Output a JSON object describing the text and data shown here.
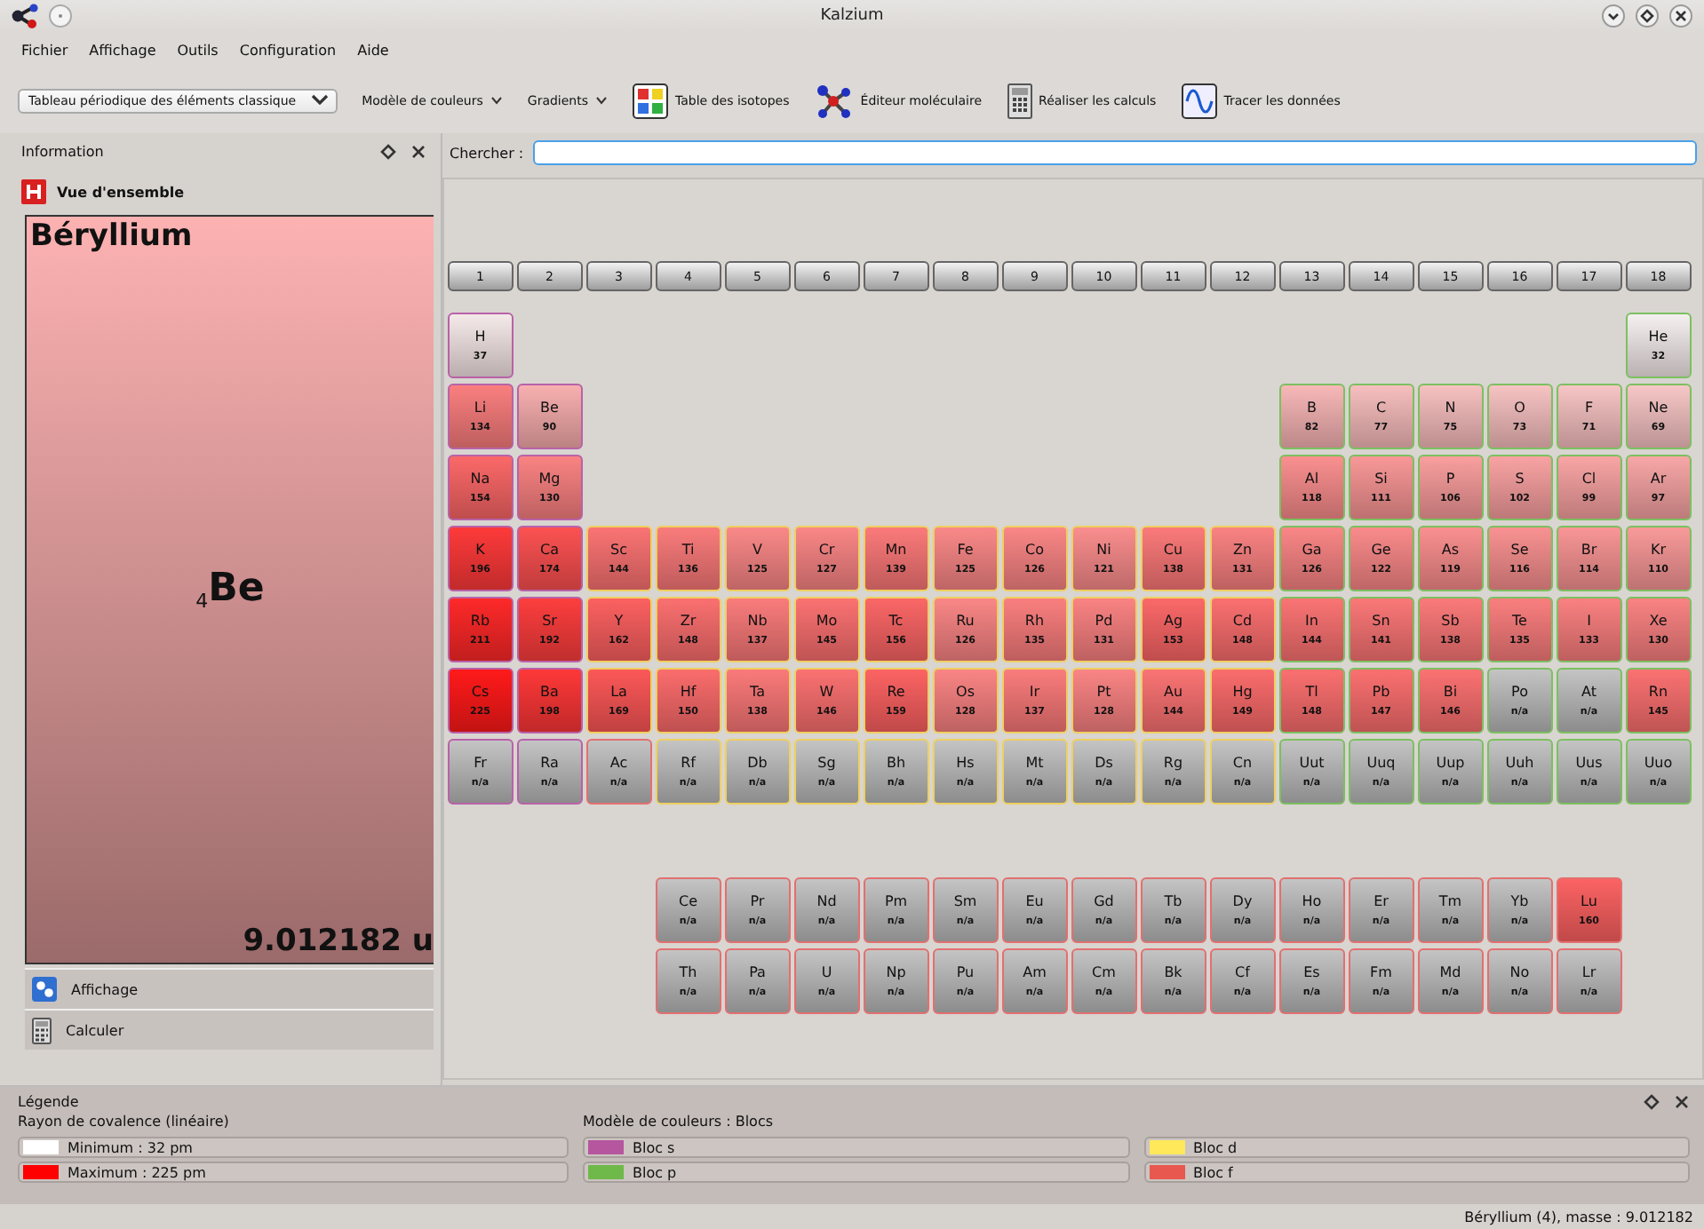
{
  "window": {
    "title": "Kalzium"
  },
  "menu": [
    "Fichier",
    "Affichage",
    "Outils",
    "Configuration",
    "Aide"
  ],
  "toolbar": {
    "table_combo": "Tableau périodique des éléments classique",
    "items": [
      {
        "label": "Modèle de couleurs",
        "kind": "dropdown"
      },
      {
        "label": "Gradients",
        "kind": "dropdown"
      },
      {
        "label": "Table des isotopes",
        "kind": "isotopes"
      },
      {
        "label": "Éditeur moléculaire",
        "kind": "molecule"
      },
      {
        "label": "Réaliser les calculs",
        "kind": "calculator"
      },
      {
        "label": "Tracer les données",
        "kind": "plot"
      }
    ]
  },
  "info_panel": {
    "title": "Information",
    "section": "Vue d'ensemble",
    "element": {
      "name": "Béryllium",
      "number": "4",
      "symbol": "Be",
      "mass": "9.012182 u"
    },
    "tabs": [
      {
        "label": "Affichage",
        "kind": "display"
      },
      {
        "label": "Calculer",
        "kind": "calculator"
      }
    ]
  },
  "search": {
    "label": "Chercher :"
  },
  "table": {
    "groups": [
      "1",
      "2",
      "3",
      "4",
      "5",
      "6",
      "7",
      "8",
      "9",
      "10",
      "11",
      "12",
      "13",
      "14",
      "15",
      "16",
      "17",
      "18"
    ],
    "rows": [
      {
        "kind": "main",
        "left": [
          {
            "symbol": "H",
            "value": "37",
            "kind": "s-block",
            "color": "#f5eaea"
          }
        ],
        "right": [
          {
            "symbol": "He",
            "value": "32",
            "kind": "p-block",
            "color": "#f5f0f0"
          }
        ]
      },
      {
        "kind": "main",
        "left": [
          {
            "symbol": "Li",
            "value": "134",
            "kind": "s-block",
            "color": "#fa7f7f"
          },
          {
            "symbol": "Be",
            "value": "90",
            "kind": "s-block",
            "color": "#f8b0b0"
          }
        ],
        "right": [
          {
            "symbol": "B",
            "value": "82",
            "kind": "p-block",
            "color": "#f8b8b8"
          },
          {
            "symbol": "C",
            "value": "77",
            "kind": "p-block",
            "color": "#f7bfbf"
          },
          {
            "symbol": "N",
            "value": "75",
            "kind": "p-block",
            "color": "#f7c1c1"
          },
          {
            "symbol": "O",
            "value": "73",
            "kind": "p-block",
            "color": "#f7c3c3"
          },
          {
            "symbol": "F",
            "value": "71",
            "kind": "p-block",
            "color": "#f7c5c5"
          },
          {
            "symbol": "Ne",
            "value": "69",
            "kind": "p-block",
            "color": "#f7c7c7"
          }
        ]
      },
      {
        "kind": "main",
        "left": [
          {
            "symbol": "Na",
            "value": "154",
            "kind": "s-block",
            "color": "#fb6969"
          },
          {
            "symbol": "Mg",
            "value": "130",
            "kind": "s-block",
            "color": "#fa8383"
          }
        ],
        "right": [
          {
            "symbol": "Al",
            "value": "118",
            "kind": "p-block",
            "color": "#fa9090"
          },
          {
            "symbol": "Si",
            "value": "111",
            "kind": "p-block",
            "color": "#f99898"
          },
          {
            "symbol": "P",
            "value": "106",
            "kind": "p-block",
            "color": "#f99f9f"
          },
          {
            "symbol": "S",
            "value": "102",
            "kind": "p-block",
            "color": "#f9a3a3"
          },
          {
            "symbol": "Cl",
            "value": "99",
            "kind": "p-block",
            "color": "#f9a5a5"
          },
          {
            "symbol": "Ar",
            "value": "97",
            "kind": "p-block",
            "color": "#f8a7a7"
          }
        ]
      },
      {
        "kind": "main",
        "left": [
          {
            "symbol": "K",
            "value": "196",
            "kind": "s-block",
            "color": "#fe3a3a"
          },
          {
            "symbol": "Ca",
            "value": "174",
            "kind": "s-block",
            "color": "#fc5252"
          },
          {
            "symbol": "Sc",
            "value": "144",
            "kind": "d-block",
            "color": "#fb7474"
          },
          {
            "symbol": "Ti",
            "value": "136",
            "kind": "d-block",
            "color": "#fa7c7c"
          },
          {
            "symbol": "V",
            "value": "125",
            "kind": "d-block",
            "color": "#fa8989"
          },
          {
            "symbol": "Cr",
            "value": "127",
            "kind": "d-block",
            "color": "#fa8787"
          },
          {
            "symbol": "Mn",
            "value": "139",
            "kind": "d-block",
            "color": "#fb7a7a"
          },
          {
            "symbol": "Fe",
            "value": "125",
            "kind": "d-block",
            "color": "#fa8989"
          },
          {
            "symbol": "Co",
            "value": "126",
            "kind": "d-block",
            "color": "#fa8787"
          },
          {
            "symbol": "Ni",
            "value": "121",
            "kind": "d-block",
            "color": "#fa8e8e"
          },
          {
            "symbol": "Cu",
            "value": "138",
            "kind": "d-block",
            "color": "#fb7a7a"
          },
          {
            "symbol": "Zn",
            "value": "131",
            "kind": "d-block",
            "color": "#fa8383"
          },
          {
            "symbol": "Ga",
            "value": "126",
            "kind": "p-block",
            "color": "#fa8787"
          },
          {
            "symbol": "Ge",
            "value": "122",
            "kind": "p-block",
            "color": "#fa8b8b"
          },
          {
            "symbol": "As",
            "value": "119",
            "kind": "p-block",
            "color": "#fa9090"
          },
          {
            "symbol": "Se",
            "value": "116",
            "kind": "p-block",
            "color": "#f99292"
          },
          {
            "symbol": "Br",
            "value": "114",
            "kind": "p-block",
            "color": "#f99696"
          },
          {
            "symbol": "Kr",
            "value": "110",
            "kind": "p-block",
            "color": "#f99a9a"
          }
        ],
        "right": []
      },
      {
        "kind": "main",
        "left": [
          {
            "symbol": "Rb",
            "value": "211",
            "kind": "s-block",
            "color": "#fe2929"
          },
          {
            "symbol": "Sr",
            "value": "192",
            "kind": "s-block",
            "color": "#fd3e3e"
          },
          {
            "symbol": "Y",
            "value": "162",
            "kind": "d-block",
            "color": "#fc6161"
          },
          {
            "symbol": "Zr",
            "value": "148",
            "kind": "d-block",
            "color": "#fb7070"
          },
          {
            "symbol": "Nb",
            "value": "137",
            "kind": "d-block",
            "color": "#fa7c7c"
          },
          {
            "symbol": "Mo",
            "value": "145",
            "kind": "d-block",
            "color": "#fb7272"
          },
          {
            "symbol": "Tc",
            "value": "156",
            "kind": "d-block",
            "color": "#fb6767"
          },
          {
            "symbol": "Ru",
            "value": "126",
            "kind": "d-block",
            "color": "#fa8787"
          },
          {
            "symbol": "Rh",
            "value": "135",
            "kind": "d-block",
            "color": "#fa7f7f"
          },
          {
            "symbol": "Pd",
            "value": "131",
            "kind": "d-block",
            "color": "#fa8383"
          },
          {
            "symbol": "Ag",
            "value": "153",
            "kind": "d-block",
            "color": "#fb6969"
          },
          {
            "symbol": "Cd",
            "value": "148",
            "kind": "d-block",
            "color": "#fb7070"
          },
          {
            "symbol": "In",
            "value": "144",
            "kind": "p-block",
            "color": "#fb7474"
          },
          {
            "symbol": "Sn",
            "value": "141",
            "kind": "p-block",
            "color": "#fb7878"
          },
          {
            "symbol": "Sb",
            "value": "138",
            "kind": "p-block",
            "color": "#fb7a7a"
          },
          {
            "symbol": "Te",
            "value": "135",
            "kind": "p-block",
            "color": "#fa7f7f"
          },
          {
            "symbol": "I",
            "value": "133",
            "kind": "p-block",
            "color": "#fa8181"
          },
          {
            "symbol": "Xe",
            "value": "130",
            "kind": "p-block",
            "color": "#fa8383"
          }
        ],
        "right": []
      },
      {
        "kind": "main",
        "left": [
          {
            "symbol": "Cs",
            "value": "225",
            "kind": "s-block",
            "color": "#ff1a1a"
          },
          {
            "symbol": "Ba",
            "value": "198",
            "kind": "s-block",
            "color": "#fe3838"
          },
          {
            "symbol": "La",
            "value": "169",
            "kind": "d-block",
            "color": "#fc5858"
          },
          {
            "symbol": "Hf",
            "value": "150",
            "kind": "d-block",
            "color": "#fb6d6d"
          },
          {
            "symbol": "Ta",
            "value": "138",
            "kind": "d-block",
            "color": "#fb7a7a"
          },
          {
            "symbol": "W",
            "value": "146",
            "kind": "d-block",
            "color": "#fb7272"
          },
          {
            "symbol": "Re",
            "value": "159",
            "kind": "d-block",
            "color": "#fc6363"
          },
          {
            "symbol": "Os",
            "value": "128",
            "kind": "d-block",
            "color": "#fa8585"
          },
          {
            "symbol": "Ir",
            "value": "137",
            "kind": "d-block",
            "color": "#fa7c7c"
          },
          {
            "symbol": "Pt",
            "value": "128",
            "kind": "d-block",
            "color": "#fa8585"
          },
          {
            "symbol": "Au",
            "value": "144",
            "kind": "d-block",
            "color": "#fb7474"
          },
          {
            "symbol": "Hg",
            "value": "149",
            "kind": "d-block",
            "color": "#fb6d6d"
          },
          {
            "symbol": "Tl",
            "value": "148",
            "kind": "p-block",
            "color": "#fb7070"
          },
          {
            "symbol": "Pb",
            "value": "147",
            "kind": "p-block",
            "color": "#fb7070"
          },
          {
            "symbol": "Bi",
            "value": "146",
            "kind": "p-block",
            "color": "#fb7272"
          },
          {
            "symbol": "Po",
            "value": "n/a",
            "kind": "p-block"
          },
          {
            "symbol": "At",
            "value": "n/a",
            "kind": "p-block"
          },
          {
            "symbol": "Rn",
            "value": "145",
            "kind": "p-block",
            "color": "#fb7272"
          }
        ],
        "right": []
      },
      {
        "kind": "main",
        "left": [
          {
            "symbol": "Fr",
            "value": "n/a",
            "kind": "s-block"
          },
          {
            "symbol": "Ra",
            "value": "n/a",
            "kind": "s-block"
          },
          {
            "symbol": "Ac",
            "value": "n/a",
            "kind": "f-block"
          },
          {
            "symbol": "Rf",
            "value": "n/a",
            "kind": "d-block"
          },
          {
            "symbol": "Db",
            "value": "n/a",
            "kind": "d-block"
          },
          {
            "symbol": "Sg",
            "value": "n/a",
            "kind": "d-block"
          },
          {
            "symbol": "Bh",
            "value": "n/a",
            "kind": "d-block"
          },
          {
            "symbol": "Hs",
            "value": "n/a",
            "kind": "d-block"
          },
          {
            "symbol": "Mt",
            "value": "n/a",
            "kind": "d-block"
          },
          {
            "symbol": "Ds",
            "value": "n/a",
            "kind": "d-block"
          },
          {
            "symbol": "Rg",
            "value": "n/a",
            "kind": "d-block"
          },
          {
            "symbol": "Cn",
            "value": "n/a",
            "kind": "d-block"
          },
          {
            "symbol": "Uut",
            "value": "n/a",
            "kind": "p-block"
          },
          {
            "symbol": "Uuq",
            "value": "n/a",
            "kind": "p-block"
          },
          {
            "symbol": "Uup",
            "value": "n/a",
            "kind": "p-block"
          },
          {
            "symbol": "Uuh",
            "value": "n/a",
            "kind": "p-block"
          },
          {
            "symbol": "Uus",
            "value": "n/a",
            "kind": "p-block"
          },
          {
            "symbol": "Uuo",
            "value": "n/a",
            "kind": "p-block"
          }
        ],
        "right": []
      },
      {
        "kind": "f-series",
        "left": [
          {
            "symbol": "Ce",
            "value": "n/a",
            "kind": "f-block"
          },
          {
            "symbol": "Pr",
            "value": "n/a",
            "kind": "f-block"
          },
          {
            "symbol": "Nd",
            "value": "n/a",
            "kind": "f-block"
          },
          {
            "symbol": "Pm",
            "value": "n/a",
            "kind": "f-block"
          },
          {
            "symbol": "Sm",
            "value": "n/a",
            "kind": "f-block"
          },
          {
            "symbol": "Eu",
            "value": "n/a",
            "kind": "f-block"
          },
          {
            "symbol": "Gd",
            "value": "n/a",
            "kind": "f-block"
          },
          {
            "symbol": "Tb",
            "value": "n/a",
            "kind": "f-block"
          },
          {
            "symbol": "Dy",
            "value": "n/a",
            "kind": "f-block"
          },
          {
            "symbol": "Ho",
            "value": "n/a",
            "kind": "f-block"
          },
          {
            "symbol": "Er",
            "value": "n/a",
            "kind": "f-block"
          },
          {
            "symbol": "Tm",
            "value": "n/a",
            "kind": "f-block"
          },
          {
            "symbol": "Yb",
            "value": "n/a",
            "kind": "f-block"
          },
          {
            "symbol": "Lu",
            "value": "160",
            "kind": "f-block",
            "color": "#fc6363"
          }
        ],
        "right": []
      },
      {
        "kind": "f-series",
        "left": [
          {
            "symbol": "Th",
            "value": "n/a",
            "kind": "f-block"
          },
          {
            "symbol": "Pa",
            "value": "n/a",
            "kind": "f-block"
          },
          {
            "symbol": "U",
            "value": "n/a",
            "kind": "f-block"
          },
          {
            "symbol": "Np",
            "value": "n/a",
            "kind": "f-block"
          },
          {
            "symbol": "Pu",
            "value": "n/a",
            "kind": "f-block"
          },
          {
            "symbol": "Am",
            "value": "n/a",
            "kind": "f-block"
          },
          {
            "symbol": "Cm",
            "value": "n/a",
            "kind": "f-block"
          },
          {
            "symbol": "Bk",
            "value": "n/a",
            "kind": "f-block"
          },
          {
            "symbol": "Cf",
            "value": "n/a",
            "kind": "f-block"
          },
          {
            "symbol": "Es",
            "value": "n/a",
            "kind": "f-block"
          },
          {
            "symbol": "Fm",
            "value": "n/a",
            "kind": "f-block"
          },
          {
            "symbol": "Md",
            "value": "n/a",
            "kind": "f-block"
          },
          {
            "symbol": "No",
            "value": "n/a",
            "kind": "f-block"
          },
          {
            "symbol": "Lr",
            "value": "n/a",
            "kind": "f-block"
          }
        ],
        "right": []
      }
    ]
  },
  "legend": {
    "title": "Légende",
    "gradient": {
      "title": "Rayon de covalence (linéaire)",
      "items": [
        {
          "label": "Minimum : 32 pm",
          "color": "#ffffff"
        },
        {
          "label": "Maximum : 225 pm",
          "color": "#ff0000"
        }
      ]
    },
    "scheme": {
      "title": "Modèle de couleurs : Blocs",
      "items": [
        {
          "label": "Bloc s",
          "color": "#b5569f"
        },
        {
          "label": "Bloc p",
          "color": "#6fb84a"
        },
        {
          "label": "Bloc d",
          "color": "#ffe85a"
        },
        {
          "label": "Bloc f",
          "color": "#e8584e"
        }
      ]
    }
  },
  "status_bar": "Béryllium (4), masse : 9.012182"
}
